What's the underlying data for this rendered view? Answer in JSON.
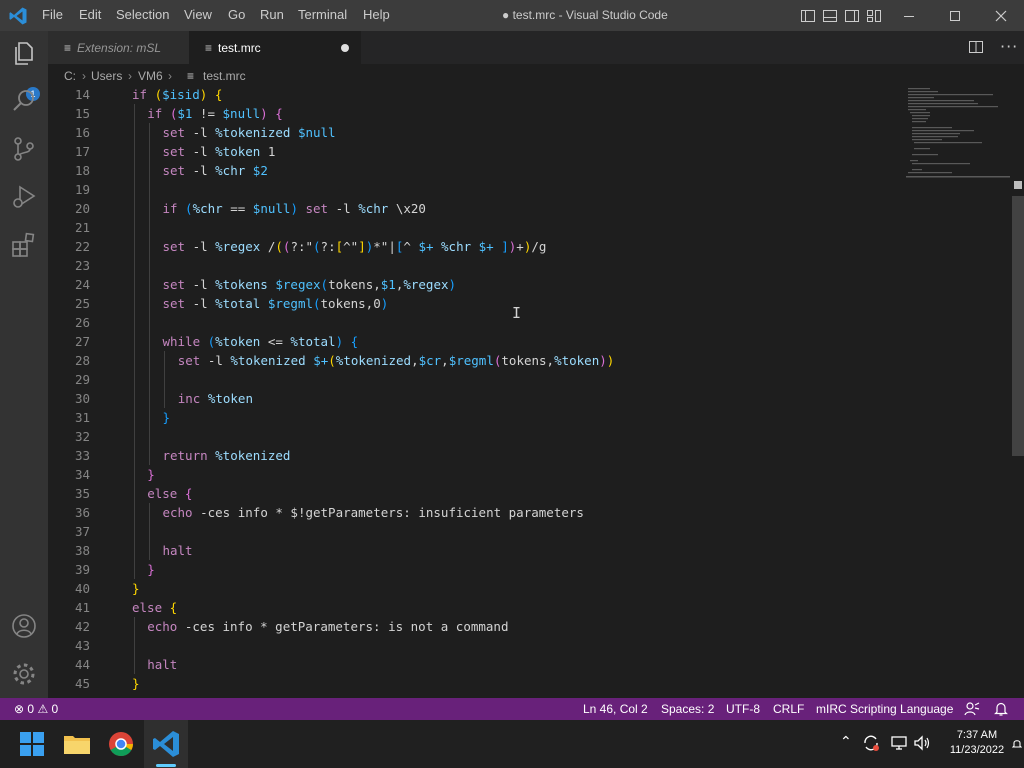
{
  "titlebar": {
    "menus": [
      "File",
      "Edit",
      "Selection",
      "View",
      "Go",
      "Run",
      "Terminal",
      "Help"
    ],
    "title": "● test.mrc - Visual Studio Code"
  },
  "activitybar": {
    "badge": "1"
  },
  "tabs": [
    {
      "label": "Extension: mSL",
      "active": false
    },
    {
      "label": "test.mrc",
      "active": true,
      "dirty": true
    }
  ],
  "breadcrumb": {
    "parts": [
      "C:",
      "Users",
      "VM6",
      "test.mrc"
    ]
  },
  "editor": {
    "lines": [
      {
        "n": "14",
        "indent": 1,
        "tokens": [
          [
            "kw",
            "if "
          ],
          [
            "br1",
            "("
          ],
          [
            "id",
            "$isid"
          ],
          [
            "br1",
            ")"
          ],
          [
            "plain",
            " "
          ],
          [
            "br1",
            "{"
          ]
        ]
      },
      {
        "n": "15",
        "indent": 2,
        "tokens": [
          [
            "kw",
            "if "
          ],
          [
            "br2",
            "("
          ],
          [
            "id",
            "$1"
          ],
          [
            "plain",
            " != "
          ],
          [
            "id",
            "$null"
          ],
          [
            "br2",
            ")"
          ],
          [
            "plain",
            " "
          ],
          [
            "br2",
            "{"
          ]
        ]
      },
      {
        "n": "16",
        "indent": 3,
        "tokens": [
          [
            "kw",
            "set "
          ],
          [
            "plain",
            "-l "
          ],
          [
            "var",
            "%tokenized "
          ],
          [
            "id",
            "$null"
          ]
        ]
      },
      {
        "n": "17",
        "indent": 3,
        "tokens": [
          [
            "kw",
            "set "
          ],
          [
            "plain",
            "-l "
          ],
          [
            "var",
            "%token "
          ],
          [
            "plain",
            "1"
          ]
        ]
      },
      {
        "n": "18",
        "indent": 3,
        "tokens": [
          [
            "kw",
            "set "
          ],
          [
            "plain",
            "-l "
          ],
          [
            "var",
            "%chr "
          ],
          [
            "id",
            "$2"
          ]
        ]
      },
      {
        "n": "19",
        "indent": 3,
        "tokens": []
      },
      {
        "n": "20",
        "indent": 3,
        "tokens": [
          [
            "kw",
            "if "
          ],
          [
            "br3",
            "("
          ],
          [
            "var",
            "%chr"
          ],
          [
            "plain",
            " == "
          ],
          [
            "id",
            "$null"
          ],
          [
            "br3",
            ")"
          ],
          [
            "plain",
            " "
          ],
          [
            "kw",
            "set "
          ],
          [
            "plain",
            "-l "
          ],
          [
            "var",
            "%chr "
          ],
          [
            "plain",
            "\\x20"
          ]
        ]
      },
      {
        "n": "21",
        "indent": 3,
        "tokens": []
      },
      {
        "n": "22",
        "indent": 3,
        "tokens": [
          [
            "kw",
            "set "
          ],
          [
            "plain",
            "-l "
          ],
          [
            "var",
            "%regex "
          ],
          [
            "plain",
            "/"
          ],
          [
            "br1",
            "("
          ],
          [
            "br2",
            "("
          ],
          [
            "plain",
            "?:\""
          ],
          [
            "br3",
            "("
          ],
          [
            "plain",
            "?:"
          ],
          [
            "br1",
            "["
          ],
          [
            "plain",
            "^\""
          ],
          [
            "br1",
            "]"
          ],
          [
            "br3",
            ")"
          ],
          [
            "plain",
            "*\"|"
          ],
          [
            "br3",
            "["
          ],
          [
            "plain",
            "^ "
          ],
          [
            "id",
            "$+ "
          ],
          [
            "var",
            "%chr "
          ],
          [
            "id",
            "$+ "
          ],
          [
            "br3",
            "]"
          ],
          [
            "br2",
            ")"
          ],
          [
            "plain",
            "+"
          ],
          [
            "br1",
            ")"
          ],
          [
            "plain",
            "/g"
          ]
        ]
      },
      {
        "n": "23",
        "indent": 3,
        "tokens": []
      },
      {
        "n": "24",
        "indent": 3,
        "tokens": [
          [
            "kw",
            "set "
          ],
          [
            "plain",
            "-l "
          ],
          [
            "var",
            "%tokens "
          ],
          [
            "id",
            "$regex"
          ],
          [
            "br3",
            "("
          ],
          [
            "plain",
            "tokens,"
          ],
          [
            "id",
            "$1"
          ],
          [
            "plain",
            ","
          ],
          [
            "var",
            "%regex"
          ],
          [
            "br3",
            ")"
          ]
        ]
      },
      {
        "n": "25",
        "indent": 3,
        "tokens": [
          [
            "kw",
            "set "
          ],
          [
            "plain",
            "-l "
          ],
          [
            "var",
            "%total "
          ],
          [
            "id",
            "$regml"
          ],
          [
            "br3",
            "("
          ],
          [
            "plain",
            "tokens,0"
          ],
          [
            "br3",
            ")"
          ]
        ]
      },
      {
        "n": "26",
        "indent": 3,
        "tokens": []
      },
      {
        "n": "27",
        "indent": 3,
        "tokens": [
          [
            "kw",
            "while "
          ],
          [
            "br3",
            "("
          ],
          [
            "var",
            "%token"
          ],
          [
            "plain",
            " <= "
          ],
          [
            "var",
            "%total"
          ],
          [
            "br3",
            ")"
          ],
          [
            "plain",
            " "
          ],
          [
            "br3",
            "{"
          ]
        ]
      },
      {
        "n": "28",
        "indent": 4,
        "tokens": [
          [
            "kw",
            "set "
          ],
          [
            "plain",
            "-l "
          ],
          [
            "var",
            "%tokenized "
          ],
          [
            "id",
            "$+"
          ],
          [
            "br1",
            "("
          ],
          [
            "var",
            "%tokenized"
          ],
          [
            "plain",
            ","
          ],
          [
            "id",
            "$cr"
          ],
          [
            "plain",
            ","
          ],
          [
            "id",
            "$regml"
          ],
          [
            "br2",
            "("
          ],
          [
            "plain",
            "tokens,"
          ],
          [
            "var",
            "%token"
          ],
          [
            "br2",
            ")"
          ],
          [
            "br1",
            ")"
          ]
        ]
      },
      {
        "n": "29",
        "indent": 4,
        "tokens": []
      },
      {
        "n": "30",
        "indent": 4,
        "tokens": [
          [
            "kw",
            "inc "
          ],
          [
            "var",
            "%token"
          ]
        ]
      },
      {
        "n": "31",
        "indent": 3,
        "tokens": [
          [
            "br3",
            "}"
          ]
        ]
      },
      {
        "n": "32",
        "indent": 3,
        "tokens": []
      },
      {
        "n": "33",
        "indent": 3,
        "tokens": [
          [
            "kw",
            "return "
          ],
          [
            "var",
            "%tokenized"
          ]
        ]
      },
      {
        "n": "34",
        "indent": 2,
        "tokens": [
          [
            "br2",
            "}"
          ]
        ]
      },
      {
        "n": "35",
        "indent": 2,
        "tokens": [
          [
            "kw",
            "else "
          ],
          [
            "br2",
            "{"
          ]
        ]
      },
      {
        "n": "36",
        "indent": 3,
        "tokens": [
          [
            "kw",
            "echo "
          ],
          [
            "plain",
            "-ces info * $!getParameters: insuficient parameters"
          ]
        ]
      },
      {
        "n": "37",
        "indent": 3,
        "tokens": []
      },
      {
        "n": "38",
        "indent": 3,
        "tokens": [
          [
            "kw",
            "halt"
          ]
        ]
      },
      {
        "n": "39",
        "indent": 2,
        "tokens": [
          [
            "br2",
            "}"
          ]
        ]
      },
      {
        "n": "40",
        "indent": 1,
        "tokens": [
          [
            "br1",
            "}"
          ]
        ]
      },
      {
        "n": "41",
        "indent": 1,
        "tokens": [
          [
            "kw",
            "else "
          ],
          [
            "br1",
            "{"
          ]
        ]
      },
      {
        "n": "42",
        "indent": 2,
        "tokens": [
          [
            "kw",
            "echo "
          ],
          [
            "plain",
            "-ces info * getParameters: is not a command"
          ]
        ]
      },
      {
        "n": "43",
        "indent": 2,
        "tokens": []
      },
      {
        "n": "44",
        "indent": 2,
        "tokens": [
          [
            "kw",
            "halt"
          ]
        ]
      },
      {
        "n": "45",
        "indent": 1,
        "tokens": [
          [
            "br1",
            "}"
          ]
        ]
      }
    ]
  },
  "statusbar": {
    "errors": "0",
    "warnings": "0",
    "position": "Ln 46, Col 2",
    "spaces": "Spaces: 2",
    "encoding": "UTF-8",
    "eol": "CRLF",
    "language": "mIRC Scripting Language"
  },
  "taskbar": {
    "time": "7:37 AM",
    "date": "11/23/2022"
  },
  "colors": {
    "statusbar": "#68217a",
    "titlebar": "#3c3c3c",
    "activitybar": "#333333",
    "editor": "#1e1e1e"
  }
}
